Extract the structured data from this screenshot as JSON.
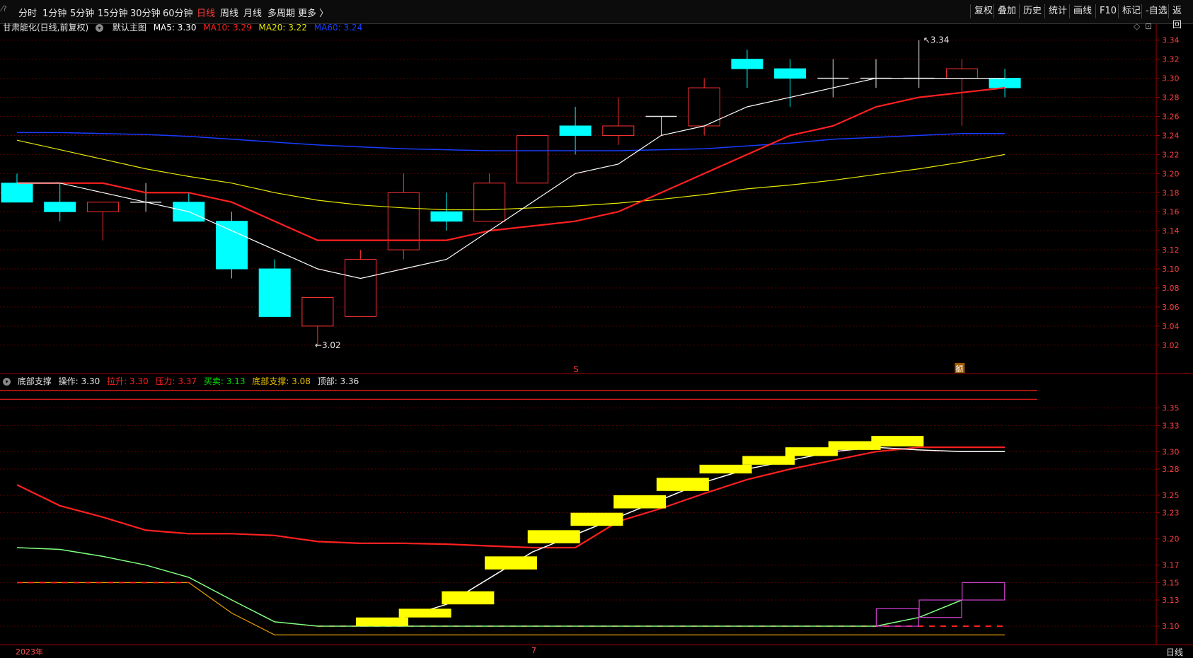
{
  "toolbar": {
    "periods": [
      "分时",
      "1分钟",
      "5分钟",
      "15分钟",
      "30分钟",
      "60分钟",
      "日线",
      "周线",
      "月线",
      "多周期",
      "更多 〉"
    ],
    "active_period": "日线",
    "right_buttons": [
      "复权",
      "叠加",
      "历史",
      "统计",
      "画线",
      "F10",
      "标记",
      "-自选",
      "返回"
    ]
  },
  "main_legend": {
    "title": "甘肃能化(日线,前复权)",
    "template": "默认主图",
    "ma5": "MA5: 3.30",
    "ma10": "MA10: 3.29",
    "ma20": "MA20: 3.22",
    "ma60": "MA60: 3.24"
  },
  "sub_legend": {
    "title": "底部支撑",
    "op": "操作: 3.30",
    "lashen": "拉升: 3.30",
    "yali": "压力: 3.37",
    "maimai": "买卖: 3.13",
    "dibu": "底部支撑: 3.08",
    "dingbu": "顶部: 3.36"
  },
  "annotations": {
    "high_label": "3.34",
    "low_label": "3.02",
    "s_marker": "S",
    "badge": "额",
    "year_label": "2023年",
    "month_label": "7",
    "period_label": "日线"
  },
  "colors": {
    "up": "#ff3232",
    "down": "#00ffff",
    "ma5": "#ffffff",
    "ma10": "#ff2020",
    "ma20": "#e8e800",
    "ma60": "#1a3cff",
    "grid": "#5a0000",
    "yellow_block": "#ffff00",
    "magenta": "#d040d0"
  },
  "chart_data": {
    "type": "candlestick",
    "main": {
      "y_ticks": [
        "3.34",
        "3.32",
        "3.30",
        "3.28",
        "3.26",
        "3.24",
        "3.22",
        "3.20",
        "3.18",
        "3.16",
        "3.14",
        "3.12",
        "3.10",
        "3.08",
        "3.06",
        "3.04",
        "3.02"
      ],
      "ylim": [
        3.005,
        3.345
      ],
      "candles": [
        {
          "o": 3.19,
          "h": 3.2,
          "l": 3.17,
          "c": 3.17
        },
        {
          "o": 3.17,
          "h": 3.19,
          "l": 3.15,
          "c": 3.16
        },
        {
          "o": 3.16,
          "h": 3.17,
          "l": 3.13,
          "c": 3.17
        },
        {
          "o": 3.17,
          "h": 3.19,
          "l": 3.16,
          "c": 3.17
        },
        {
          "o": 3.17,
          "h": 3.18,
          "l": 3.15,
          "c": 3.15
        },
        {
          "o": 3.15,
          "h": 3.16,
          "l": 3.09,
          "c": 3.1
        },
        {
          "o": 3.1,
          "h": 3.11,
          "l": 3.05,
          "c": 3.05
        },
        {
          "o": 3.04,
          "h": 3.07,
          "l": 3.02,
          "c": 3.07
        },
        {
          "o": 3.05,
          "h": 3.12,
          "l": 3.05,
          "c": 3.11
        },
        {
          "o": 3.12,
          "h": 3.2,
          "l": 3.11,
          "c": 3.18
        },
        {
          "o": 3.16,
          "h": 3.18,
          "l": 3.14,
          "c": 3.15
        },
        {
          "o": 3.15,
          "h": 3.2,
          "l": 3.15,
          "c": 3.19
        },
        {
          "o": 3.19,
          "h": 3.24,
          "l": 3.19,
          "c": 3.24
        },
        {
          "o": 3.25,
          "h": 3.27,
          "l": 3.22,
          "c": 3.24
        },
        {
          "o": 3.24,
          "h": 3.28,
          "l": 3.23,
          "c": 3.25
        },
        {
          "o": 3.26,
          "h": 3.26,
          "l": 3.24,
          "c": 3.26
        },
        {
          "o": 3.25,
          "h": 3.3,
          "l": 3.24,
          "c": 3.29
        },
        {
          "o": 3.32,
          "h": 3.33,
          "l": 3.29,
          "c": 3.31
        },
        {
          "o": 3.31,
          "h": 3.32,
          "l": 3.27,
          "c": 3.3
        },
        {
          "o": 3.3,
          "h": 3.32,
          "l": 3.28,
          "c": 3.3
        },
        {
          "o": 3.3,
          "h": 3.32,
          "l": 3.29,
          "c": 3.3
        },
        {
          "o": 3.3,
          "h": 3.34,
          "l": 3.29,
          "c": 3.3
        },
        {
          "o": 3.3,
          "h": 3.32,
          "l": 3.25,
          "c": 3.31
        },
        {
          "o": 3.3,
          "h": 3.31,
          "l": 3.28,
          "c": 3.29
        }
      ],
      "ma5": [
        3.19,
        3.19,
        3.18,
        3.17,
        3.16,
        3.14,
        3.12,
        3.1,
        3.09,
        3.1,
        3.11,
        3.14,
        3.17,
        3.2,
        3.21,
        3.24,
        3.25,
        3.27,
        3.28,
        3.29,
        3.3,
        3.3,
        3.3,
        3.3
      ],
      "ma10": [
        3.19,
        3.19,
        3.19,
        3.18,
        3.18,
        3.17,
        3.15,
        3.13,
        3.13,
        3.13,
        3.13,
        3.14,
        3.145,
        3.15,
        3.16,
        3.18,
        3.2,
        3.22,
        3.24,
        3.25,
        3.27,
        3.28,
        3.285,
        3.29
      ],
      "ma20": [
        3.235,
        3.225,
        3.215,
        3.205,
        3.197,
        3.19,
        3.18,
        3.172,
        3.167,
        3.164,
        3.162,
        3.162,
        3.164,
        3.166,
        3.169,
        3.173,
        3.178,
        3.184,
        3.188,
        3.193,
        3.199,
        3.205,
        3.212,
        3.22
      ],
      "ma60": [
        3.243,
        3.243,
        3.242,
        3.241,
        3.239,
        3.236,
        3.233,
        3.23,
        3.228,
        3.226,
        3.225,
        3.224,
        3.224,
        3.224,
        3.224,
        3.225,
        3.226,
        3.229,
        3.232,
        3.236,
        3.238,
        3.24,
        3.242,
        3.242
      ]
    },
    "sub": {
      "y_ticks": [
        "3.35",
        "3.33",
        "3.30",
        "3.28",
        "3.25",
        "3.23",
        "3.20",
        "3.17",
        "3.15",
        "3.13",
        "3.10"
      ],
      "ylim": [
        3.083,
        3.37
      ],
      "top_lines": [
        3.37,
        3.36
      ],
      "red_line": [
        3.262,
        3.238,
        3.225,
        3.21,
        3.206,
        3.206,
        3.204,
        3.197,
        3.195,
        3.195,
        3.194,
        3.192,
        3.19,
        3.19,
        3.22,
        3.235,
        3.252,
        3.268,
        3.28,
        3.29,
        3.3,
        3.305,
        3.305,
        3.305
      ],
      "green_line": [
        3.19,
        3.188,
        3.18,
        3.17,
        3.156,
        3.13,
        3.105,
        3.1,
        3.1,
        3.1,
        3.1,
        3.1,
        3.1,
        3.1,
        3.1,
        3.1,
        3.1,
        3.1,
        3.1,
        3.1,
        3.1,
        3.11,
        3.13
      ],
      "white_line": [
        null,
        null,
        null,
        null,
        null,
        null,
        null,
        null,
        3.1,
        3.11,
        3.125,
        3.155,
        3.185,
        3.205,
        3.225,
        3.245,
        3.265,
        3.28,
        3.29,
        3.3,
        3.305,
        3.302,
        3.3,
        3.3
      ],
      "orange_line": [
        3.15,
        3.15,
        3.15,
        3.15,
        3.15,
        3.115,
        3.09,
        3.09,
        3.09,
        3.09,
        3.09,
        3.09,
        3.09,
        3.09,
        3.09,
        3.09,
        3.09,
        3.09,
        3.09,
        3.09,
        3.09,
        3.09,
        3.09,
        3.09
      ],
      "dash_line": [
        3.15,
        3.15,
        3.15,
        3.15,
        3.15,
        null,
        null,
        3.1,
        3.1,
        3.1,
        3.1,
        3.1,
        3.1,
        3.1,
        3.1,
        3.1,
        3.1,
        3.1,
        3.1,
        3.1,
        3.1,
        3.1,
        3.1,
        3.1
      ],
      "yellow_blocks": [
        {
          "i": 8.5,
          "lo": 3.1,
          "hi": 3.11
        },
        {
          "i": 9.5,
          "lo": 3.11,
          "hi": 3.12
        },
        {
          "i": 10.5,
          "lo": 3.125,
          "hi": 3.14
        },
        {
          "i": 11.5,
          "lo": 3.165,
          "hi": 3.18
        },
        {
          "i": 12.5,
          "lo": 3.195,
          "hi": 3.21
        },
        {
          "i": 13.5,
          "lo": 3.215,
          "hi": 3.23
        },
        {
          "i": 14.5,
          "lo": 3.235,
          "hi": 3.25
        },
        {
          "i": 15.5,
          "lo": 3.255,
          "hi": 3.27
        },
        {
          "i": 16.5,
          "lo": 3.275,
          "hi": 3.285
        },
        {
          "i": 17.5,
          "lo": 3.285,
          "hi": 3.295
        },
        {
          "i": 18.5,
          "lo": 3.295,
          "hi": 3.305
        },
        {
          "i": 19.5,
          "lo": 3.302,
          "hi": 3.312
        },
        {
          "i": 20.5,
          "lo": 3.306,
          "hi": 3.318
        }
      ],
      "magenta_boxes": [
        {
          "i": 20.5,
          "lo": 3.1,
          "hi": 3.12
        },
        {
          "i": 21.5,
          "lo": 3.11,
          "hi": 3.13
        },
        {
          "i": 22.5,
          "lo": 3.13,
          "hi": 3.15
        }
      ]
    }
  }
}
